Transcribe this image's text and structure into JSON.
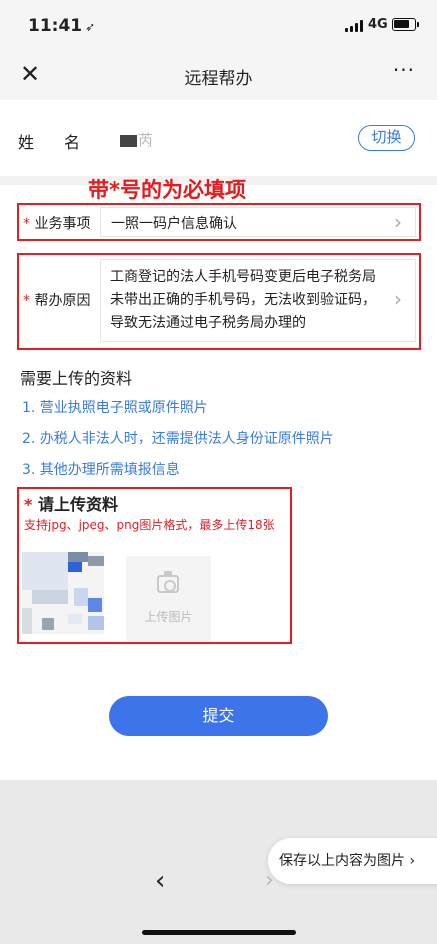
{
  "status_bar": {
    "time": "11:41",
    "network": "4G"
  },
  "nav": {
    "title": "远程帮办",
    "close_icon": "close-icon",
    "more_label": "···"
  },
  "name_row": {
    "label": "姓名",
    "value_suffix": "芮",
    "switch_label": "切换"
  },
  "annotation": {
    "note": "带*号的为必填项"
  },
  "fields": {
    "business": {
      "required": "*",
      "label": "业务事项",
      "value": "一照一码户信息确认"
    },
    "reason": {
      "required": "*",
      "label": "帮办原因",
      "value": "工商登记的法人手机号码变更后电子税务局未带出正确的手机号码，无法收到验证码，导致无法通过电子税务局办理的"
    }
  },
  "materials": {
    "title": "需要上传的资料",
    "items": [
      "1. 营业执照电子照或原件照片",
      "2. 办税人非法人时，还需提供法人身份证原件照片",
      "3. 其他办理所需填报信息"
    ]
  },
  "upload": {
    "required": "*",
    "title": "请上传资料",
    "hint": "支持jpg、jpeg、png图片格式，最多上传18张",
    "add_label": "上传图片"
  },
  "submit_label": "提交",
  "bottom": {
    "save_label": "保存以上内容为图片 ›",
    "back": "‹",
    "forward": "›"
  },
  "colors": {
    "accent": "#3e74ea",
    "link": "#3a7be3",
    "annotation": "#e61e24"
  }
}
